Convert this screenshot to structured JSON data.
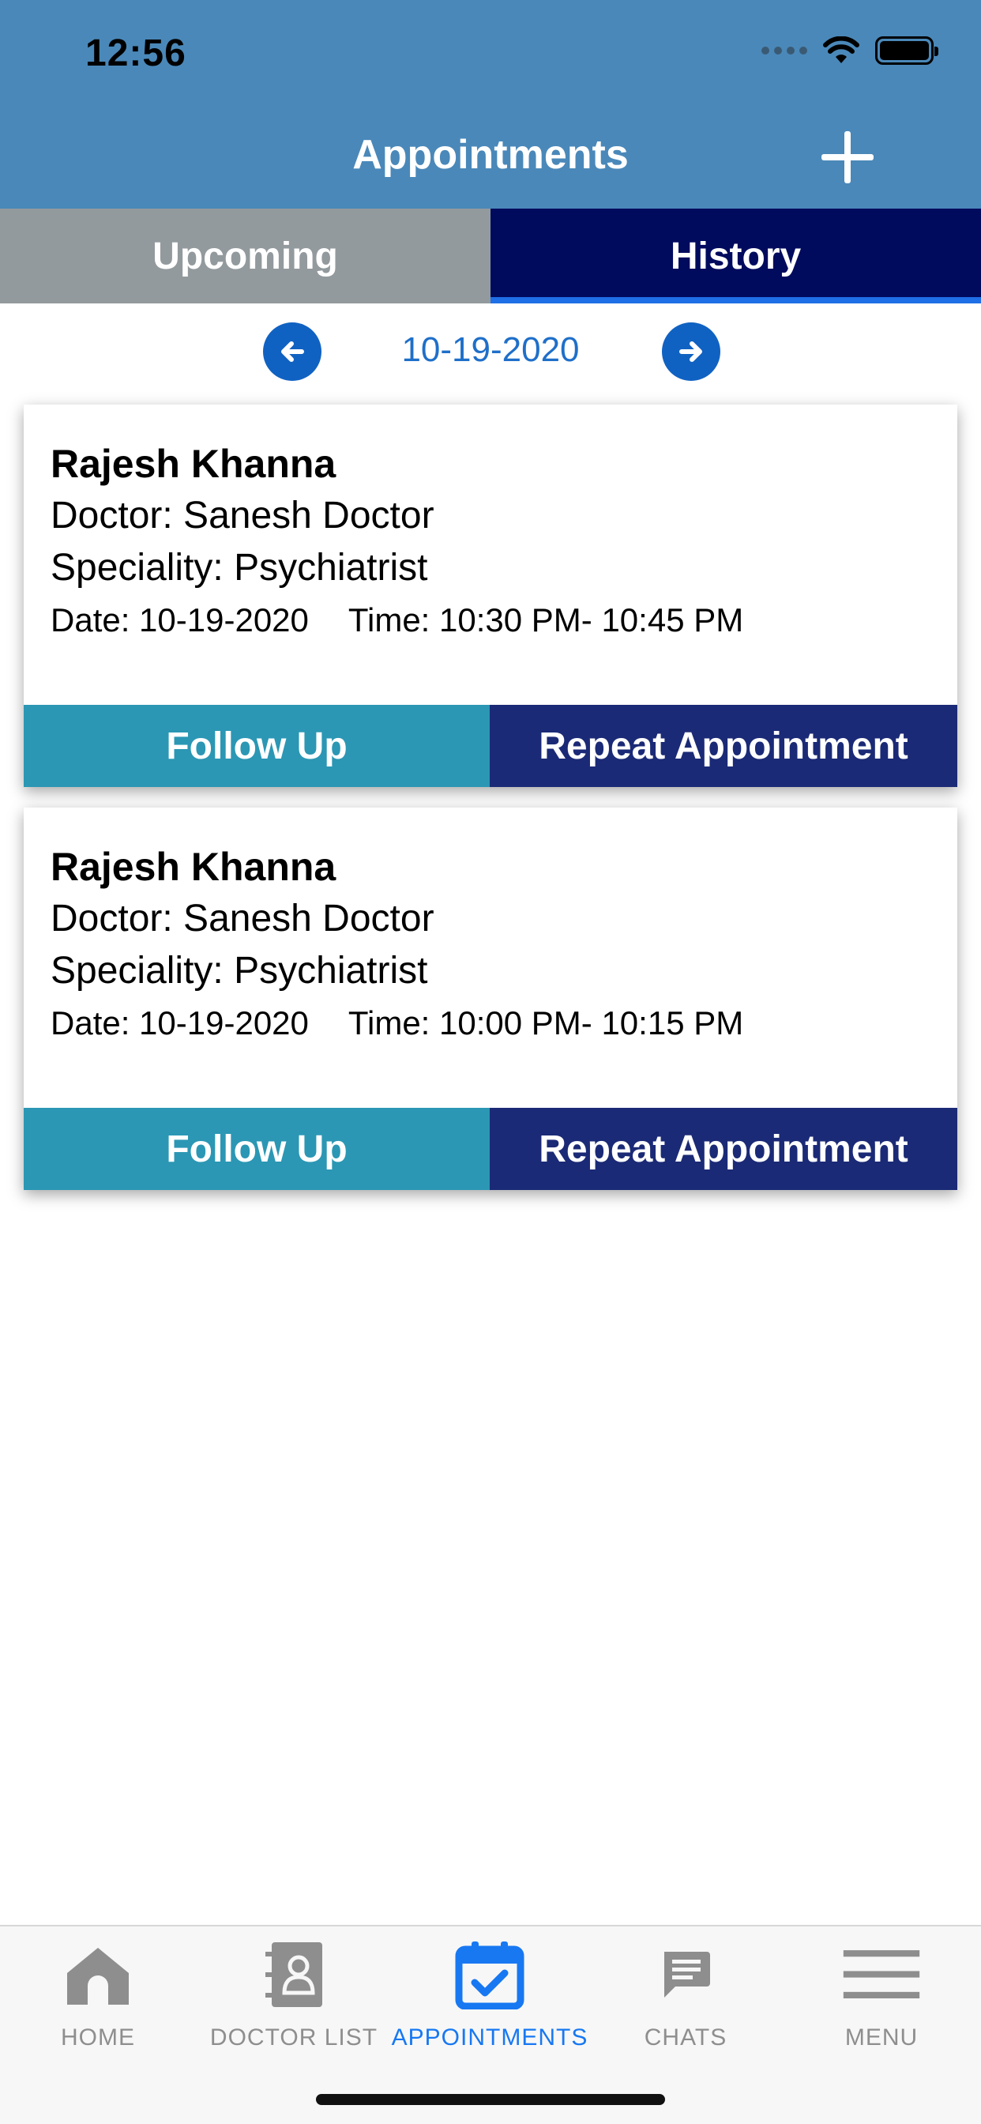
{
  "status_bar": {
    "time": "12:56"
  },
  "header": {
    "title": "Appointments",
    "add_icon": "plus-icon"
  },
  "tabs": [
    {
      "label": "Upcoming",
      "active": false
    },
    {
      "label": "History",
      "active": true
    }
  ],
  "date_nav": {
    "date": "10-19-2020",
    "prev_icon": "arrow-left-icon",
    "next_icon": "arrow-right-icon"
  },
  "appointments": [
    {
      "patient": "Rajesh Khanna",
      "doctor": "Doctor: Sanesh  Doctor",
      "speciality": "Speciality: Psychiatrist",
      "date": "Date: 10-19-2020",
      "time": "Time: 10:30 PM- 10:45 PM",
      "follow_up_label": "Follow Up",
      "repeat_label": "Repeat Appointment"
    },
    {
      "patient": "Rajesh Khanna",
      "doctor": "Doctor: Sanesh  Doctor",
      "speciality": "Speciality: Psychiatrist",
      "date": "Date: 10-19-2020",
      "time": "Time: 10:00 PM- 10:15 PM",
      "follow_up_label": "Follow Up",
      "repeat_label": "Repeat Appointment"
    }
  ],
  "tab_bar": [
    {
      "label": "HOME",
      "icon": "home-icon",
      "active": false
    },
    {
      "label": "DOCTOR LIST",
      "icon": "contact-book-icon",
      "active": false
    },
    {
      "label": "APPOINTMENTS",
      "icon": "calendar-check-icon",
      "active": true
    },
    {
      "label": "CHATS",
      "icon": "chat-bubble-icon",
      "active": false
    },
    {
      "label": "MENU",
      "icon": "hamburger-menu-icon",
      "active": false
    }
  ],
  "colors": {
    "header": "#4a88b9",
    "tab_inactive": "#939a9e",
    "tab_active": "#000b5e",
    "follow_up": "#2b97b4",
    "repeat": "#1b2a76",
    "active_tab_bar": "#1778f2"
  }
}
